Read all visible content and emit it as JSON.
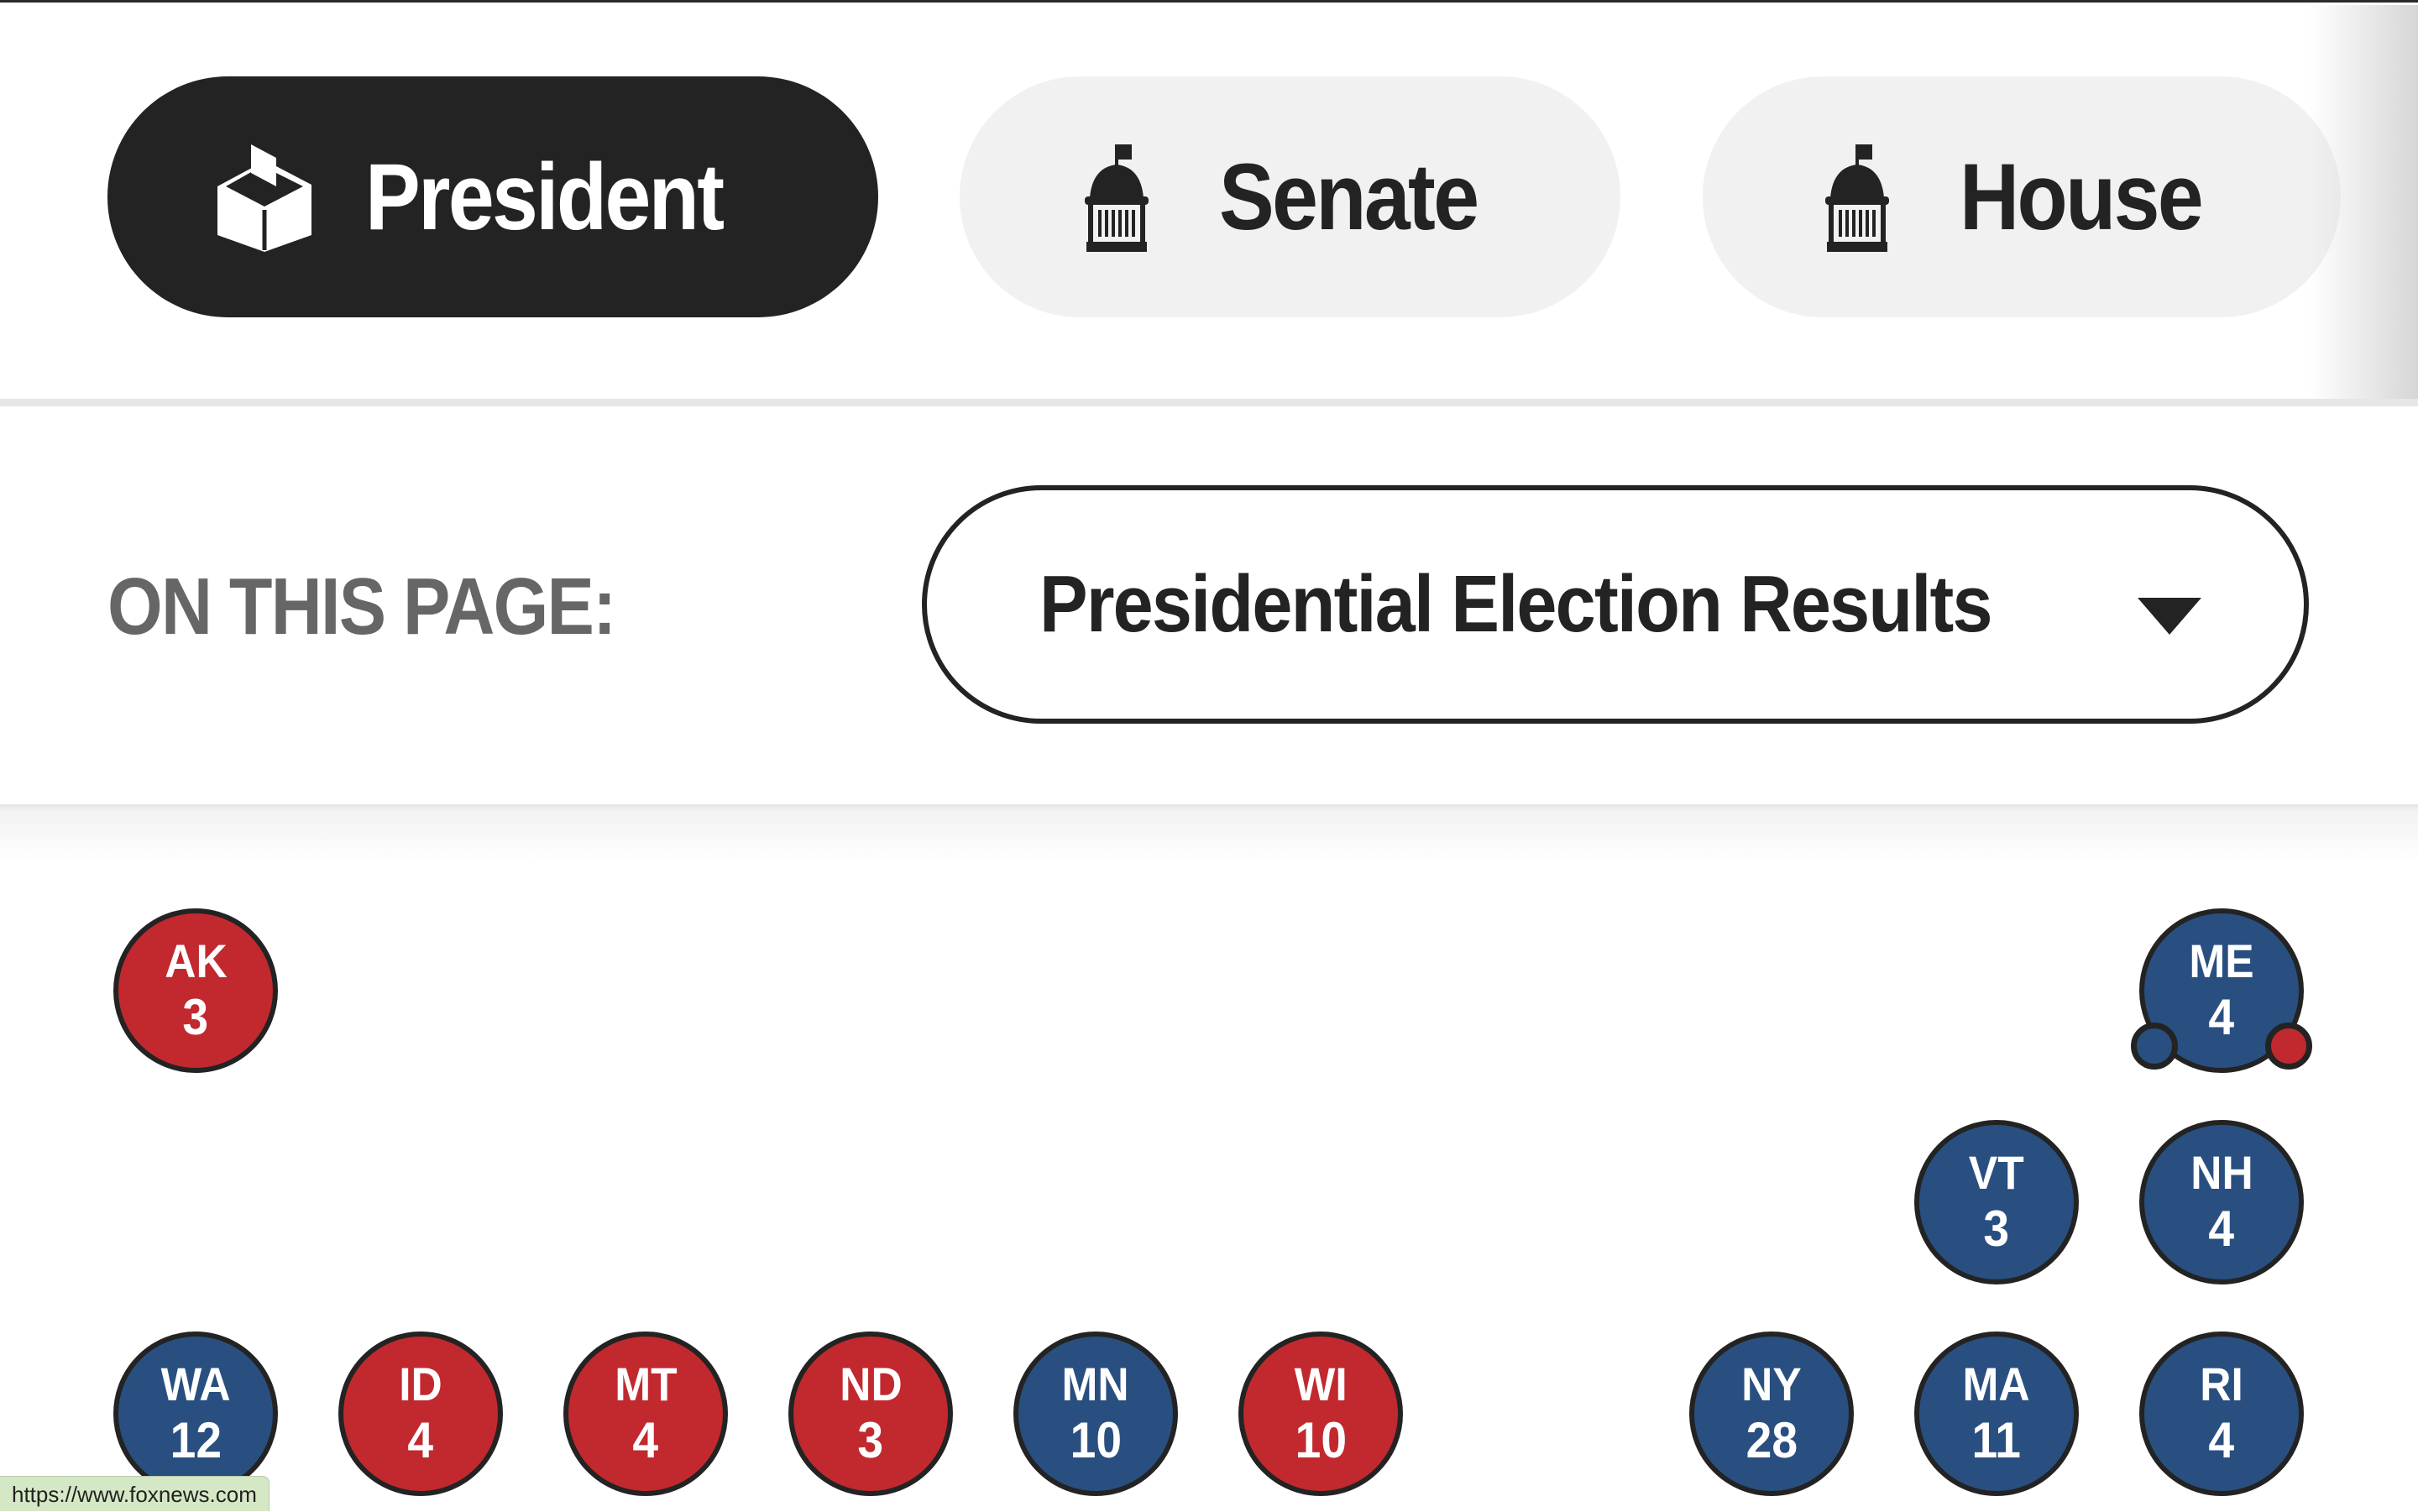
{
  "tabs": [
    {
      "label": "President",
      "icon": "ballot-box-icon",
      "active": true
    },
    {
      "label": "Senate",
      "icon": "capitol-dome-icon",
      "active": false
    },
    {
      "label": "House",
      "icon": "capitol-dome-icon",
      "active": false
    }
  ],
  "on_this_page": {
    "label": "ON THIS PAGE:",
    "selected": "Presidential Election Results",
    "caret_icon": "caret-down-icon"
  },
  "colors": {
    "republican": "#c1292e",
    "democrat": "#294f80",
    "dark": "#232323",
    "inactive_tab": "#f1f1f1",
    "label_gray": "#666666"
  },
  "states": [
    {
      "abbr": "AK",
      "ev": "3",
      "party": "R"
    },
    {
      "abbr": "ME",
      "ev": "4",
      "party": "D",
      "districts": [
        {
          "party": "D"
        },
        {
          "party": "R"
        }
      ]
    },
    {
      "abbr": "VT",
      "ev": "3",
      "party": "D"
    },
    {
      "abbr": "NH",
      "ev": "4",
      "party": "D"
    },
    {
      "abbr": "WA",
      "ev": "12",
      "party": "D"
    },
    {
      "abbr": "ID",
      "ev": "4",
      "party": "R"
    },
    {
      "abbr": "MT",
      "ev": "4",
      "party": "R"
    },
    {
      "abbr": "ND",
      "ev": "3",
      "party": "R"
    },
    {
      "abbr": "MN",
      "ev": "10",
      "party": "D"
    },
    {
      "abbr": "WI",
      "ev": "10",
      "party": "R"
    },
    {
      "abbr": "NY",
      "ev": "28",
      "party": "D"
    },
    {
      "abbr": "MA",
      "ev": "11",
      "party": "D"
    },
    {
      "abbr": "RI",
      "ev": "4",
      "party": "D"
    }
  ],
  "status_bar": {
    "url": "https://www.foxnews.com"
  }
}
